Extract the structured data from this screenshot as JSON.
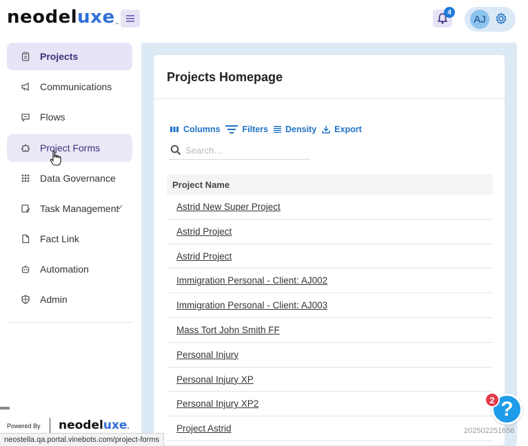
{
  "brand": {
    "logo_main": "neodel",
    "logo_accent": "uxe",
    "logo_tm": "™"
  },
  "header": {
    "notification_count": "4",
    "avatar_initials": "AJ"
  },
  "sidebar": {
    "items": [
      {
        "label": "Projects",
        "icon": "clipboard-icon"
      },
      {
        "label": "Communications",
        "icon": "megaphone-icon"
      },
      {
        "label": "Flows",
        "icon": "chat-icon"
      },
      {
        "label": "Project Forms",
        "icon": "puzzle-icon"
      },
      {
        "label": "Data Governance",
        "icon": "grid-icon"
      },
      {
        "label": "Task Management",
        "icon": "task-icon"
      },
      {
        "label": "Fact Link",
        "icon": "document-icon"
      },
      {
        "label": "Automation",
        "icon": "robot-icon"
      },
      {
        "label": "Admin",
        "icon": "shield-icon"
      }
    ],
    "task_chevron": "✓",
    "powered_by": "Powered By",
    "powered_logo_main": "neodel",
    "powered_logo_accent": "uxe",
    "powered_logo_tm": "."
  },
  "main": {
    "title": "Projects Homepage",
    "toolbar": {
      "columns": "Columns",
      "filters": "Filters",
      "density": "Density",
      "export": "Export"
    },
    "search_placeholder": "Search…",
    "table": {
      "column_header": "Project Name",
      "rows": [
        "Astrid New Super Project",
        "Astrid Project",
        "Astrid Project",
        "Immigration Personal - Client: AJ002",
        "Immigration Personal - Client: AJ003",
        "Mass Tort John Smith FF",
        "Personal Injury",
        "Personal Injury XP",
        "Personal Injury XP2",
        "Project Astrid"
      ]
    }
  },
  "help": {
    "badge": "2",
    "label": "?"
  },
  "build_id": "202502251656",
  "status_url": "neostella.qa.portal.vinebots.com/project-forms",
  "colors": {
    "accent": "#2f6fd6",
    "active_nav_bg": "#e8e4f7",
    "link_blue": "#1f72c7",
    "help_blue": "#1e9be9",
    "badge_red": "#e23b4b"
  }
}
